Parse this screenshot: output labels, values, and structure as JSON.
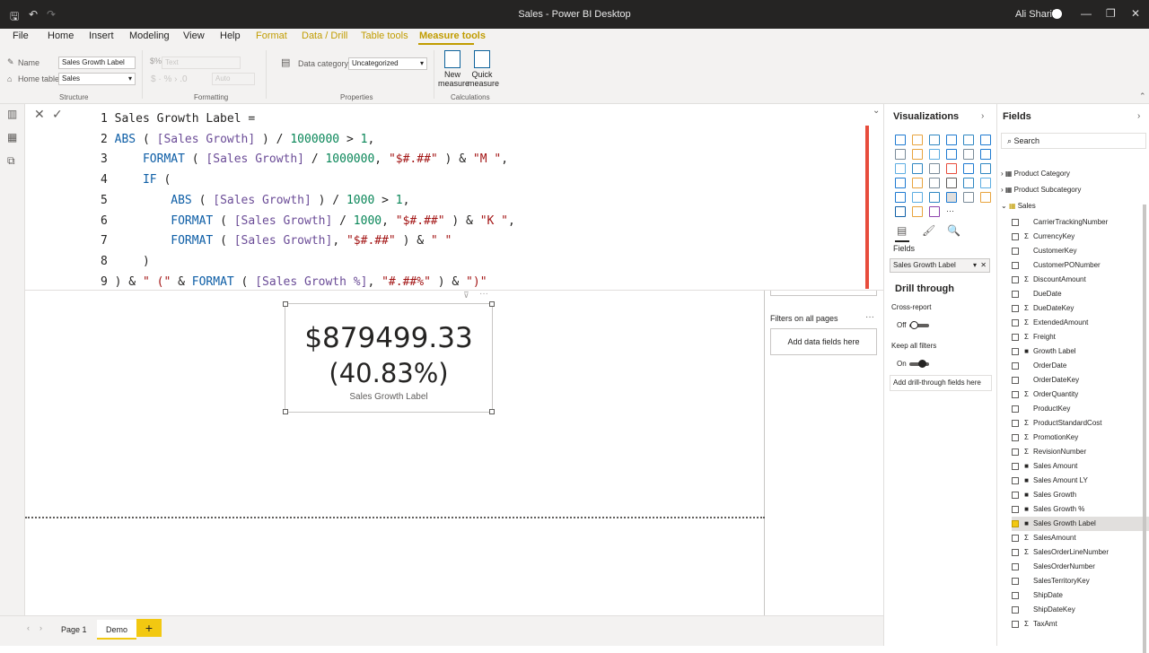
{
  "app": {
    "title": "Sales - Power BI Desktop",
    "user": "Ali Sharifi"
  },
  "menu": {
    "items": [
      "File",
      "Home",
      "Insert",
      "Modeling",
      "View",
      "Help",
      "Format",
      "Data / Drill",
      "Table tools",
      "Measure tools"
    ],
    "active": "Measure tools"
  },
  "ribbon": {
    "name_label": "Name",
    "name_value": "Sales Growth Label",
    "home_table_label": "Home table",
    "home_table_value": "Sales",
    "structure_title": "Structure",
    "format_value": "Text",
    "auto_value": "Auto",
    "formatting_title": "Formatting",
    "data_category_label": "Data category",
    "data_category_value": "Uncategorized",
    "properties_title": "Properties",
    "new_measure": "New measure",
    "quick_measure": "Quick measure",
    "calculations_title": "Calculations"
  },
  "formula": {
    "lines": [
      "1 Sales Growth Label =",
      "2 ABS ( [Sales Growth] ) / 1000000 > 1,",
      "3     FORMAT ( [Sales Growth] / 1000000, \"$#.##\" ) & \"M \",",
      "4     IF (",
      "5         ABS ( [Sales Growth] ) / 1000 > 1,",
      "6         FORMAT ( [Sales Growth] / 1000, \"$#.##\" ) & \"K \",",
      "7         FORMAT ( [Sales Growth], \"$#.##\" ) & \" \"",
      "8     )",
      "9 ) & \" (\" & FORMAT ( [Sales Growth %], \"#.##%\" ) & \")\""
    ]
  },
  "card": {
    "value_line1": "$879499.33",
    "value_line2": "(40.83%)",
    "label": "Sales Growth Label"
  },
  "filters": {
    "header": "Filters on all pages",
    "dropzone": "Add data fields here"
  },
  "visualizations": {
    "title": "Visualizations",
    "fields_label": "Fields",
    "well_value": "Sales Growth Label",
    "drill_through": "Drill through",
    "cross_report": "Cross-report",
    "cross_report_state": "Off",
    "keep_all_filters": "Keep all filters",
    "keep_all_filters_state": "On",
    "drill_dropzone": "Add drill-through fields here"
  },
  "fields_pane": {
    "title": "Fields",
    "search_placeholder": "Search",
    "tables": [
      "Product Category",
      "Product Subcategory",
      "Sales"
    ],
    "items": [
      {
        "name": "CarrierTrackingNumber",
        "type": "",
        "checked": false
      },
      {
        "name": "CurrencyKey",
        "type": "Σ",
        "checked": false
      },
      {
        "name": "CustomerKey",
        "type": "",
        "checked": false
      },
      {
        "name": "CustomerPONumber",
        "type": "",
        "checked": false
      },
      {
        "name": "DiscountAmount",
        "type": "Σ",
        "checked": false
      },
      {
        "name": "DueDate",
        "type": "",
        "checked": false
      },
      {
        "name": "DueDateKey",
        "type": "Σ",
        "checked": false
      },
      {
        "name": "ExtendedAmount",
        "type": "Σ",
        "checked": false
      },
      {
        "name": "Freight",
        "type": "Σ",
        "checked": false
      },
      {
        "name": "Growth Label",
        "type": "■",
        "checked": false
      },
      {
        "name": "OrderDate",
        "type": "",
        "checked": false
      },
      {
        "name": "OrderDateKey",
        "type": "",
        "checked": false
      },
      {
        "name": "OrderQuantity",
        "type": "Σ",
        "checked": false
      },
      {
        "name": "ProductKey",
        "type": "",
        "checked": false
      },
      {
        "name": "ProductStandardCost",
        "type": "Σ",
        "checked": false
      },
      {
        "name": "PromotionKey",
        "type": "Σ",
        "checked": false
      },
      {
        "name": "RevisionNumber",
        "type": "Σ",
        "checked": false
      },
      {
        "name": "Sales Amount",
        "type": "■",
        "checked": false
      },
      {
        "name": "Sales Amount LY",
        "type": "■",
        "checked": false
      },
      {
        "name": "Sales Growth",
        "type": "■",
        "checked": false
      },
      {
        "name": "Sales Growth %",
        "type": "■",
        "checked": false
      },
      {
        "name": "Sales Growth Label",
        "type": "■",
        "checked": true
      },
      {
        "name": "SalesAmount",
        "type": "Σ",
        "checked": false
      },
      {
        "name": "SalesOrderLineNumber",
        "type": "Σ",
        "checked": false
      },
      {
        "name": "SalesOrderNumber",
        "type": "",
        "checked": false
      },
      {
        "name": "SalesTerritoryKey",
        "type": "",
        "checked": false
      },
      {
        "name": "ShipDate",
        "type": "",
        "checked": false
      },
      {
        "name": "ShipDateKey",
        "type": "",
        "checked": false
      },
      {
        "name": "TaxAmt",
        "type": "Σ",
        "checked": false
      }
    ]
  },
  "pages": {
    "tabs": [
      "Page 1",
      "Demo"
    ],
    "active": "Demo",
    "add": "+"
  }
}
